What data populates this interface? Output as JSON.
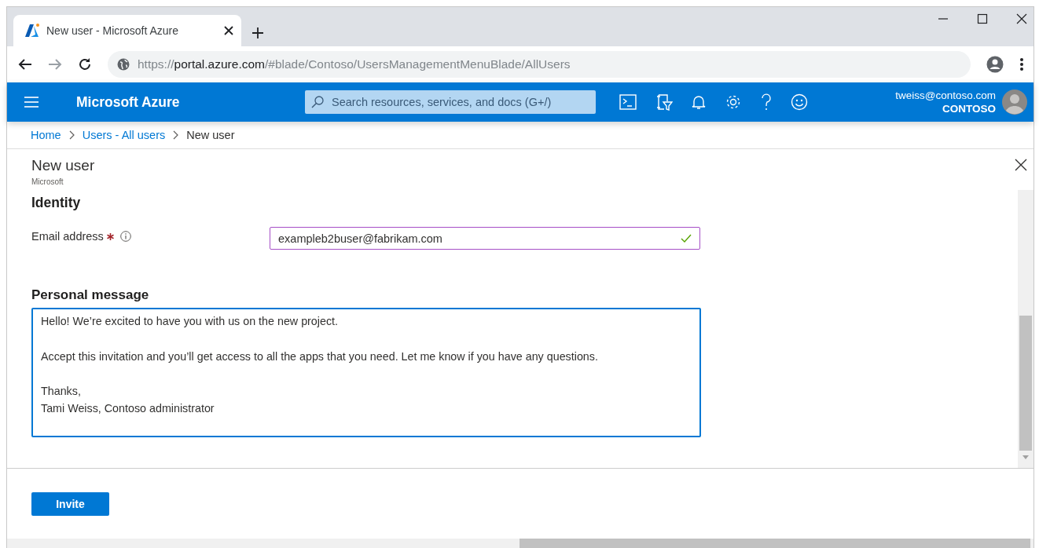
{
  "browser": {
    "tab": {
      "title": "New user - Microsoft Azure",
      "selected": true
    },
    "url": {
      "scheme": "https://",
      "host": "portal.azure.com",
      "path": "/#blade/Contoso/UsersManagementMenuBlade/AllUsers"
    }
  },
  "portal": {
    "brand": "Microsoft Azure",
    "search": {
      "placeholder": "Search resources, services, and docs (G+/)"
    },
    "account": {
      "email": "tweiss@contoso.com",
      "tenant": "CONTOSO"
    }
  },
  "breadcrumb": [
    {
      "label": "Home",
      "kind": "link"
    },
    {
      "label": "Users - All users",
      "kind": "link"
    },
    {
      "label": "New user",
      "kind": "current"
    }
  ],
  "blade": {
    "title": "New user",
    "subtitle": "Microsoft",
    "section": "Identity",
    "email": {
      "label": "Email address",
      "required": true,
      "value": "exampleb2buser@fabrikam.com",
      "valid": true
    },
    "message": {
      "label": "Personal message",
      "value": "Hello! We’re excited to have you with us on the new project.\n\nAccept this invitation and you’ll get access to all the apps that you need. Let me know if you have any questions.\n\nThanks,\nTami Weiss, Contoso administrator"
    },
    "buttons": [
      "Invite"
    ]
  }
}
